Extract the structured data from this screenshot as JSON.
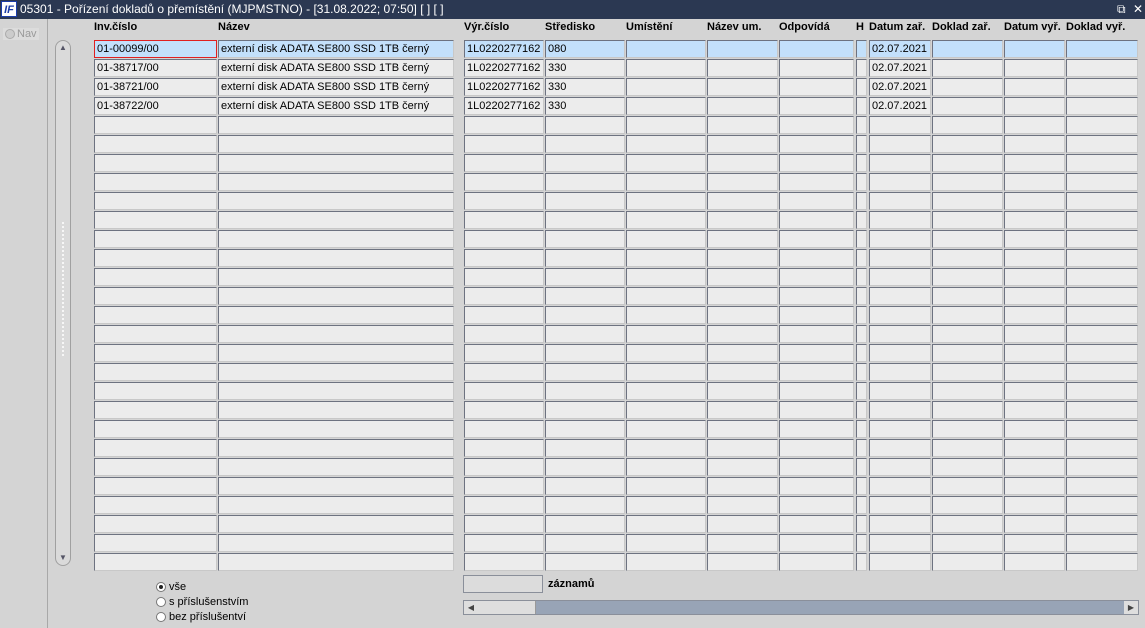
{
  "window": {
    "logo": "IF",
    "title": "05301 - Pořízení dokladů o přemístění (MJPMSTNO) - [31.08.2022; 07:50]  [ ]  [ ]",
    "restore_icon": "restore-icon",
    "close_icon": "close-icon"
  },
  "nav": {
    "label": "Nav"
  },
  "columns": [
    "Inv.číslo",
    "Název",
    "Výr.číslo",
    "Středisko",
    "Umístění",
    "Název um.",
    "Odpovídá",
    "H",
    "Datum zař.",
    "Doklad zař.",
    "Datum vyř.",
    "Doklad vyř."
  ],
  "rows": [
    [
      "01-00099/00",
      "externí disk ADATA SE800 SSD 1TB černý",
      "1L0220277162",
      "080",
      "",
      "",
      "",
      "",
      "02.07.2021",
      "",
      "",
      ""
    ],
    [
      "01-38717/00",
      "externí disk ADATA SE800 SSD 1TB černý",
      "1L0220277162",
      "330",
      "",
      "",
      "",
      "",
      "02.07.2021",
      "",
      "",
      ""
    ],
    [
      "01-38721/00",
      "externí disk ADATA SE800 SSD 1TB černý",
      "1L0220277162",
      "330",
      "",
      "",
      "",
      "",
      "02.07.2021",
      "",
      "",
      ""
    ],
    [
      "01-38722/00",
      "externí disk ADATA SE800 SSD 1TB černý",
      "1L0220277162",
      "330",
      "",
      "",
      "",
      "",
      "02.07.2021",
      "",
      "",
      ""
    ]
  ],
  "filter": {
    "options": [
      "vše",
      "s příslušenstvím",
      "bez příslušentví"
    ],
    "selected": 0
  },
  "records": {
    "value": "",
    "label": "záznamů"
  }
}
